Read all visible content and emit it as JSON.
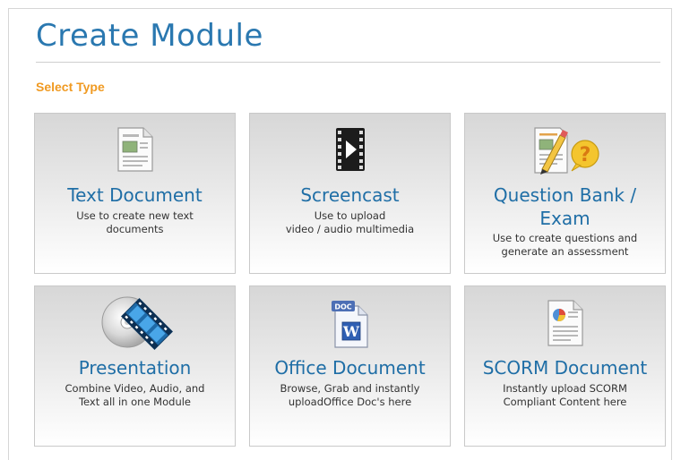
{
  "page": {
    "title": "Create Module",
    "subtitle": "Select Type"
  },
  "cards": [
    {
      "name": "Text Document",
      "desc1": "Use to create new text",
      "desc2": "documents",
      "icon": "text-document-icon"
    },
    {
      "name": "Screencast",
      "desc1": "Use to upload",
      "desc2": "video / audio multimedia",
      "icon": "film-play-icon"
    },
    {
      "name1": "Question Bank /",
      "name2": "Exam",
      "desc1": "Use to create questions and",
      "desc2": "generate an assessment",
      "icon": "question-bank-icon"
    },
    {
      "name": "Presentation",
      "desc1": "Combine Video, Audio, and",
      "desc2": "Text all in one Module",
      "icon": "cd-film-icon"
    },
    {
      "name": "Office Document",
      "desc1": "Browse, Grab and instantly",
      "desc2": "uploadOffice Doc's here",
      "icon": "word-doc-icon",
      "icon_label_top": "DOC",
      "icon_label_main": "W"
    },
    {
      "name": "SCORM Document",
      "desc1": "Instantly upload SCORM",
      "desc2": "Compliant Content here",
      "icon": "scorm-chart-document-icon"
    }
  ],
  "colors": {
    "title": "#2a78b0",
    "subtitle": "#f09a22",
    "card_name": "#1f6ea6"
  }
}
